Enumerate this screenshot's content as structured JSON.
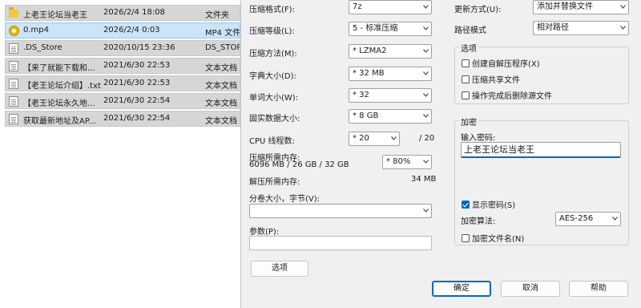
{
  "explorer": {
    "files": [
      {
        "name": "上老王论坛当老王",
        "date": "2026/2/4 18:08",
        "type": "文件夹",
        "icon": "folder-icon",
        "selected": false
      },
      {
        "name": "0.mp4",
        "date": "2026/2/4 0:03",
        "type": "MP4 文件",
        "icon": "media-file-icon",
        "selected": true
      },
      {
        "name": ".DS_Store",
        "date": "2020/10/15 23:36",
        "type": "DS_STORE",
        "icon": "blank-file-icon",
        "selected": false
      },
      {
        "name": "【来了就能下载和...",
        "date": "2021/6/30 22:53",
        "type": "文本文档",
        "icon": "text-file-icon",
        "selected": false
      },
      {
        "name": "【老王论坛介绍】.txt",
        "date": "2021/6/30 22:53",
        "type": "文本文档",
        "icon": "text-file-icon",
        "selected": false
      },
      {
        "name": "【老王论坛永久地...",
        "date": "2021/6/30 22:54",
        "type": "文本文档",
        "icon": "text-file-icon",
        "selected": false
      },
      {
        "name": "获取最新地址及AP...",
        "date": "2021/6/30 22:54",
        "type": "文本文档",
        "icon": "text-file-icon",
        "selected": false
      }
    ]
  },
  "dialog": {
    "archive_format": {
      "label": "压缩格式(F):",
      "value": "7z"
    },
    "compression_level": {
      "label": "压缩等级(L):",
      "value": "5 - 标准压缩"
    },
    "compression_method": {
      "label": "压缩方法(M):",
      "value": "* LZMA2"
    },
    "dictionary_size": {
      "label": "字典大小(D):",
      "value": "* 32 MB"
    },
    "word_size": {
      "label": "单词大小(W):",
      "value": "* 32"
    },
    "solid_block_size": {
      "label": "固实数据大小:",
      "value": "* 8 GB"
    },
    "cpu_threads": {
      "label": "CPU 线程数:",
      "value": "* 20",
      "max": "/ 20"
    },
    "memory_compress": {
      "label": "压缩所需内存:",
      "detail": "6096 MB / 26 GB / 32 GB",
      "value": "* 80%"
    },
    "memory_decompress": {
      "label": "解压所需内存:",
      "value": "34 MB"
    },
    "split_volumes": {
      "label": "分卷大小，字节(V):",
      "value": ""
    },
    "parameters": {
      "label": "参数(P):",
      "value": ""
    },
    "options_button": "选项",
    "update_mode": {
      "label": "更新方式(U):",
      "value": "添加并替换文件"
    },
    "path_mode": {
      "label": "路径模式",
      "value": "相对路径"
    },
    "options_group": {
      "title": "选项",
      "sfx": {
        "label": "创建自解压程序(X)",
        "checked": false
      },
      "shared": {
        "label": "压缩共享文件",
        "checked": false
      },
      "delete_after": {
        "label": "操作完成后删除源文件",
        "checked": false
      }
    },
    "encryption": {
      "title": "加密",
      "password_label": "输入密码:",
      "password_value": "上老王论坛当老王",
      "show_password": {
        "label": "显示密码(S)",
        "checked": true
      },
      "method_label": "加密算法:",
      "method_value": "AES-256",
      "encrypt_names": {
        "label": "加密文件名(N)",
        "checked": false
      }
    },
    "buttons": {
      "ok": "确定",
      "cancel": "取消",
      "help": "帮助"
    }
  },
  "colors": {
    "accent": "#0067c0",
    "selection": "#cce4f7",
    "dialog_bg": "#f0f0f0"
  }
}
